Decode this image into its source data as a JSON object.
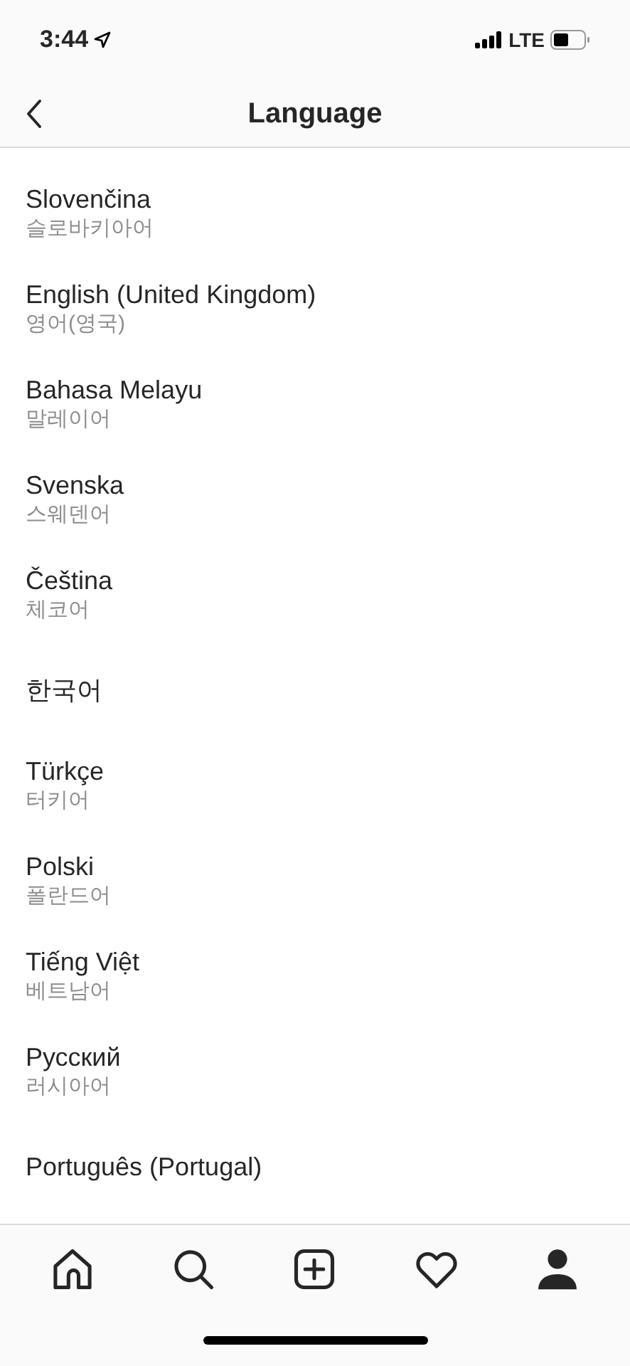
{
  "status_bar": {
    "time": "3:44",
    "network": "LTE"
  },
  "header": {
    "title": "Language"
  },
  "languages": [
    {
      "name": "Slovenčina",
      "native": "슬로바키아어"
    },
    {
      "name": "English (United Kingdom)",
      "native": "영어(영국)"
    },
    {
      "name": "Bahasa Melayu",
      "native": "말레이어"
    },
    {
      "name": "Svenska",
      "native": "스웨덴어"
    },
    {
      "name": "Čeština",
      "native": "체코어"
    },
    {
      "name": "한국어"
    },
    {
      "name": "Türkçe",
      "native": "터키어"
    },
    {
      "name": "Polski",
      "native": "폴란드어"
    },
    {
      "name": "Tiếng Việt",
      "native": "베트남어"
    },
    {
      "name": "Русский",
      "native": "러시아어"
    },
    {
      "name": "Português (Portugal)"
    }
  ],
  "tab_bar": [
    {
      "kind": "home"
    },
    {
      "kind": "search"
    },
    {
      "kind": "add"
    },
    {
      "kind": "heart"
    },
    {
      "kind": "profile"
    }
  ]
}
